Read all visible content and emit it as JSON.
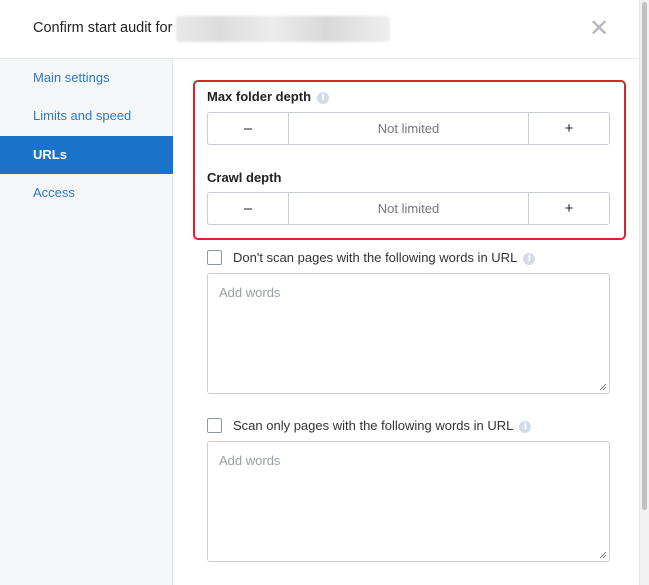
{
  "dialog": {
    "title": "Confirm start audit for",
    "close_glyph": "✕"
  },
  "sidebar": {
    "items": [
      {
        "label": "Main settings",
        "active": false
      },
      {
        "label": "Limits and speed",
        "active": false
      },
      {
        "label": "URLs",
        "active": true
      },
      {
        "label": "Access",
        "active": false
      }
    ]
  },
  "urls": {
    "max_folder_depth": {
      "label": "Max folder depth",
      "value": "Not limited",
      "minus": "–",
      "plus": "+"
    },
    "crawl_depth": {
      "label": "Crawl depth",
      "value": "Not limited",
      "minus": "–",
      "plus": "+"
    },
    "exclude_words": {
      "label": "Don't scan pages with the following words in URL",
      "checked": false,
      "placeholder": "Add words"
    },
    "include_words": {
      "label": "Scan only pages with the following words in URL",
      "checked": false,
      "placeholder": "Add words"
    }
  },
  "icons": {
    "info": "i",
    "highlight_color": "#d9242b",
    "accent": "#1a73c8"
  }
}
